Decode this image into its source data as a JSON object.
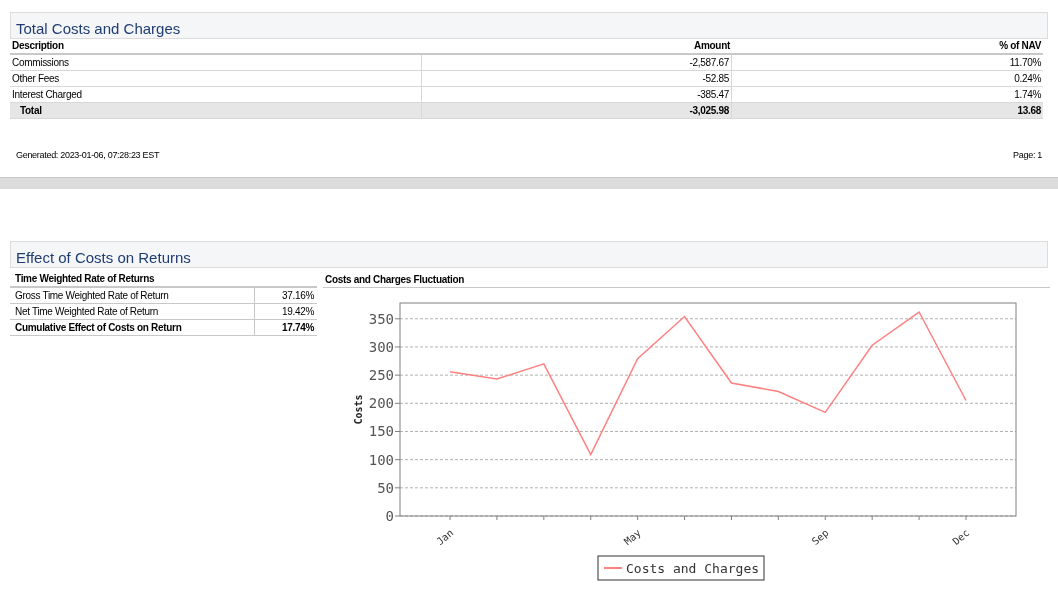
{
  "costs": {
    "title": "Total Costs and Charges",
    "columns": [
      "Description",
      "Amount",
      "% of NAV"
    ],
    "rows": [
      {
        "kind": "item",
        "cells": [
          "Commissions",
          "-2,587.67",
          "11.70%"
        ]
      },
      {
        "kind": "item",
        "cells": [
          "Other Fees",
          "-52.85",
          "0.24%"
        ]
      },
      {
        "kind": "item",
        "cells": [
          "Interest Charged",
          "-385.47",
          "1.74%"
        ]
      },
      {
        "kind": "total",
        "cells": [
          "Total",
          "-3,025.98",
          "13.68"
        ]
      }
    ]
  },
  "footer": {
    "generated": "Generated: 2023-01-06, 07:28:23 EST",
    "page": "Page: 1"
  },
  "effect": {
    "title": "Effect of Costs on Returns",
    "returns": {
      "title": "Time Weighted Rate of Returns",
      "rows": [
        {
          "kind": "item",
          "label": "Gross Time Weighted Rate of Return",
          "value": "37.16%"
        },
        {
          "kind": "item",
          "label": "Net Time Weighted Rate of Return",
          "value": "19.42%"
        },
        {
          "kind": "total",
          "label": "Cumulative Effect of Costs on Return",
          "value": "17.74%"
        }
      ]
    },
    "chart": {
      "title": "Costs and Charges Fluctuation",
      "chart_data": {
        "type": "line",
        "ylabel": "Costs",
        "categories": [
          "Jan",
          null,
          null,
          null,
          "May",
          null,
          null,
          null,
          "Sep",
          null,
          null,
          "Dec"
        ],
        "series": [
          {
            "name": "Costs and Charges",
            "color": "#ff8080",
            "values": [
              256,
              243,
              270,
              109,
              279,
              354,
              236,
              221,
              184,
              303,
              362,
              205
            ]
          }
        ],
        "ylim": [
          0,
          378
        ],
        "grid": true,
        "yticks": [
          0,
          50,
          100,
          150,
          200,
          250,
          300,
          350
        ]
      }
    }
  }
}
